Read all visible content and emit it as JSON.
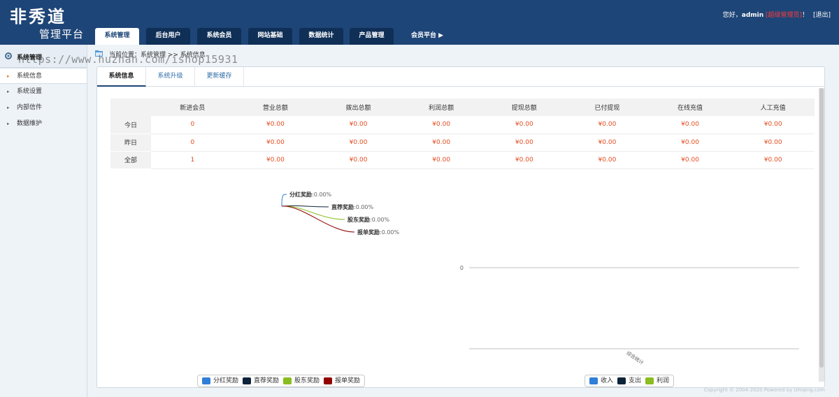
{
  "header": {
    "logo_main": "非秀道",
    "logo_sub": "管理平台",
    "tabs": [
      "系统管理",
      "后台用户",
      "系统会员",
      "网站基础",
      "数据统计",
      "产品管理",
      "会员平台"
    ],
    "greeting": "您好，",
    "username": "admin",
    "role": "[超级管理员]",
    "exclaim": "！",
    "logout": "[退出]"
  },
  "sidebar": {
    "title": "系统管理",
    "items": [
      "系统信息",
      "系统设置",
      "内部信件",
      "数据维护"
    ]
  },
  "breadcrumb": "当前位置：系统管理 >> 系统信息",
  "watermark": "https://www.huzhan.com/ishop15931",
  "subtabs": [
    "系统信息",
    "系统升级",
    "更新缓存"
  ],
  "table": {
    "headers": [
      "新进会员",
      "营业总额",
      "拨出总额",
      "利润总额",
      "提现总额",
      "已付提现",
      "在线充值",
      "人工充值"
    ],
    "rows": [
      {
        "label": "今日",
        "cells": [
          "0",
          "¥0.00",
          "¥0.00",
          "¥0.00",
          "¥0.00",
          "¥0.00",
          "¥0.00",
          "¥0.00"
        ]
      },
      {
        "label": "昨日",
        "cells": [
          "0",
          "¥0.00",
          "¥0.00",
          "¥0.00",
          "¥0.00",
          "¥0.00",
          "¥0.00",
          "¥0.00"
        ]
      },
      {
        "label": "全部",
        "cells": [
          "1",
          "¥0.00",
          "¥0.00",
          "¥0.00",
          "¥0.00",
          "¥0.00",
          "¥0.00",
          "¥0.00"
        ]
      }
    ]
  },
  "chart_data": [
    {
      "type": "pie",
      "labels": [
        "分红奖励",
        "直荐奖励",
        "股东奖励",
        "报单奖励"
      ],
      "values": [
        0,
        0,
        0,
        0
      ],
      "data_labels": [
        "分红奖励:0.00%",
        "直荐奖励:0.00%",
        "股东奖励:0.00%",
        "报单奖励:0.00%"
      ],
      "colors": [
        "#2f7ed8",
        "#0d233a",
        "#8bbc21",
        "#910000"
      ],
      "legend": "bottom"
    },
    {
      "type": "bar",
      "series": [
        {
          "name": "收入",
          "values": []
        },
        {
          "name": "支出",
          "values": []
        },
        {
          "name": "利润",
          "values": []
        }
      ],
      "colors": [
        "#2f7ed8",
        "#0d233a",
        "#8bbc21"
      ],
      "ytick_labels": [
        "0"
      ],
      "xtick_labels": [
        "综合统计"
      ],
      "legend": "bottom"
    }
  ],
  "footer": "Copyright © 2004-2020 Powered by lzhiqing.com"
}
